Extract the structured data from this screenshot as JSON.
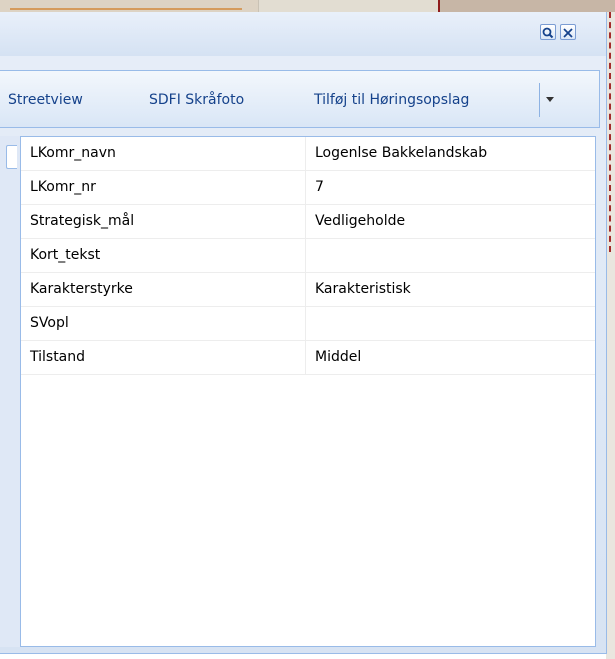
{
  "toolbar": {
    "streetview_label": "Streetview",
    "skraafoto_label": "SDFI Skråfoto",
    "add_to_hearing_label": "Tilføj til Høringsopslag"
  },
  "attributes": {
    "rows": [
      {
        "field": "LKomr_navn",
        "value": "Logenlse Bakkelandskab"
      },
      {
        "field": "LKomr_nr",
        "value": "7"
      },
      {
        "field": "Strategisk_mål",
        "value": "Vedligeholde"
      },
      {
        "field": "Kort_tekst",
        "value": ""
      },
      {
        "field": "Karakterstyrke",
        "value": "Karakteristisk"
      },
      {
        "field": "SVopl",
        "value": ""
      },
      {
        "field": "Tilstand",
        "value": "Middel"
      }
    ]
  },
  "icons": {
    "title_buttons": [
      "search-icon",
      "close-icon"
    ],
    "toolbar_dropdown": "chevron-down-icon"
  },
  "colors": {
    "toolbar_text": "#15428b",
    "window_border": "#99bbe8",
    "map_boundary": "#a42a2a"
  }
}
